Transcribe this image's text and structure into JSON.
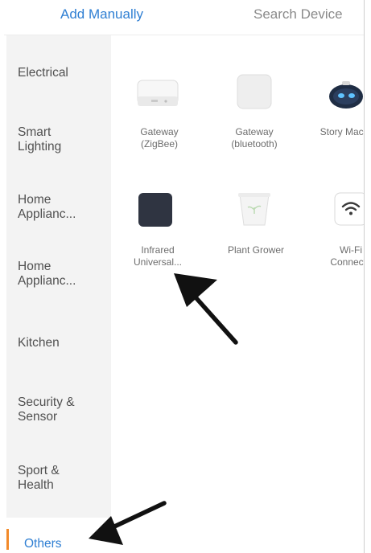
{
  "tabs": {
    "add_manually": "Add Manually",
    "search_device": "Search Device"
  },
  "sidebar": {
    "items": [
      {
        "line1": "Electrical",
        "line2": ""
      },
      {
        "line1": "Smart",
        "line2": "Lighting"
      },
      {
        "line1": "Home",
        "line2": "Applianc..."
      },
      {
        "line1": "Home",
        "line2": "Applianc..."
      },
      {
        "line1": "Kitchen",
        "line2": ""
      },
      {
        "line1": "Security &",
        "line2": "Sensor"
      },
      {
        "line1": "Sport &",
        "line2": "Health"
      }
    ],
    "selected": "Others"
  },
  "devices": [
    {
      "line1": "Gateway",
      "line2": "(ZigBee)",
      "icon": "zigbee-gateway-icon"
    },
    {
      "line1": "Gateway",
      "line2": "(bluetooth)",
      "icon": "bluetooth-gateway-icon"
    },
    {
      "line1": "Story Mach",
      "line2": "",
      "icon": "story-machine-robot-icon"
    },
    {
      "line1": "Infrared",
      "line2": "Universal...",
      "icon": "infrared-remote-icon"
    },
    {
      "line1": "Plant Grower",
      "line2": "",
      "icon": "plant-pot-icon"
    },
    {
      "line1": "Wi-Fi",
      "line2": "Connecto",
      "icon": "wifi-connector-icon"
    }
  ],
  "colors": {
    "accent_blue": "#2f7fd3",
    "selected_bar": "#f28a2a",
    "sidebar_bg": "#f3f3f3"
  },
  "annotations": [
    "arrow-pointing-to-infrared-universal",
    "arrow-pointing-to-others"
  ]
}
